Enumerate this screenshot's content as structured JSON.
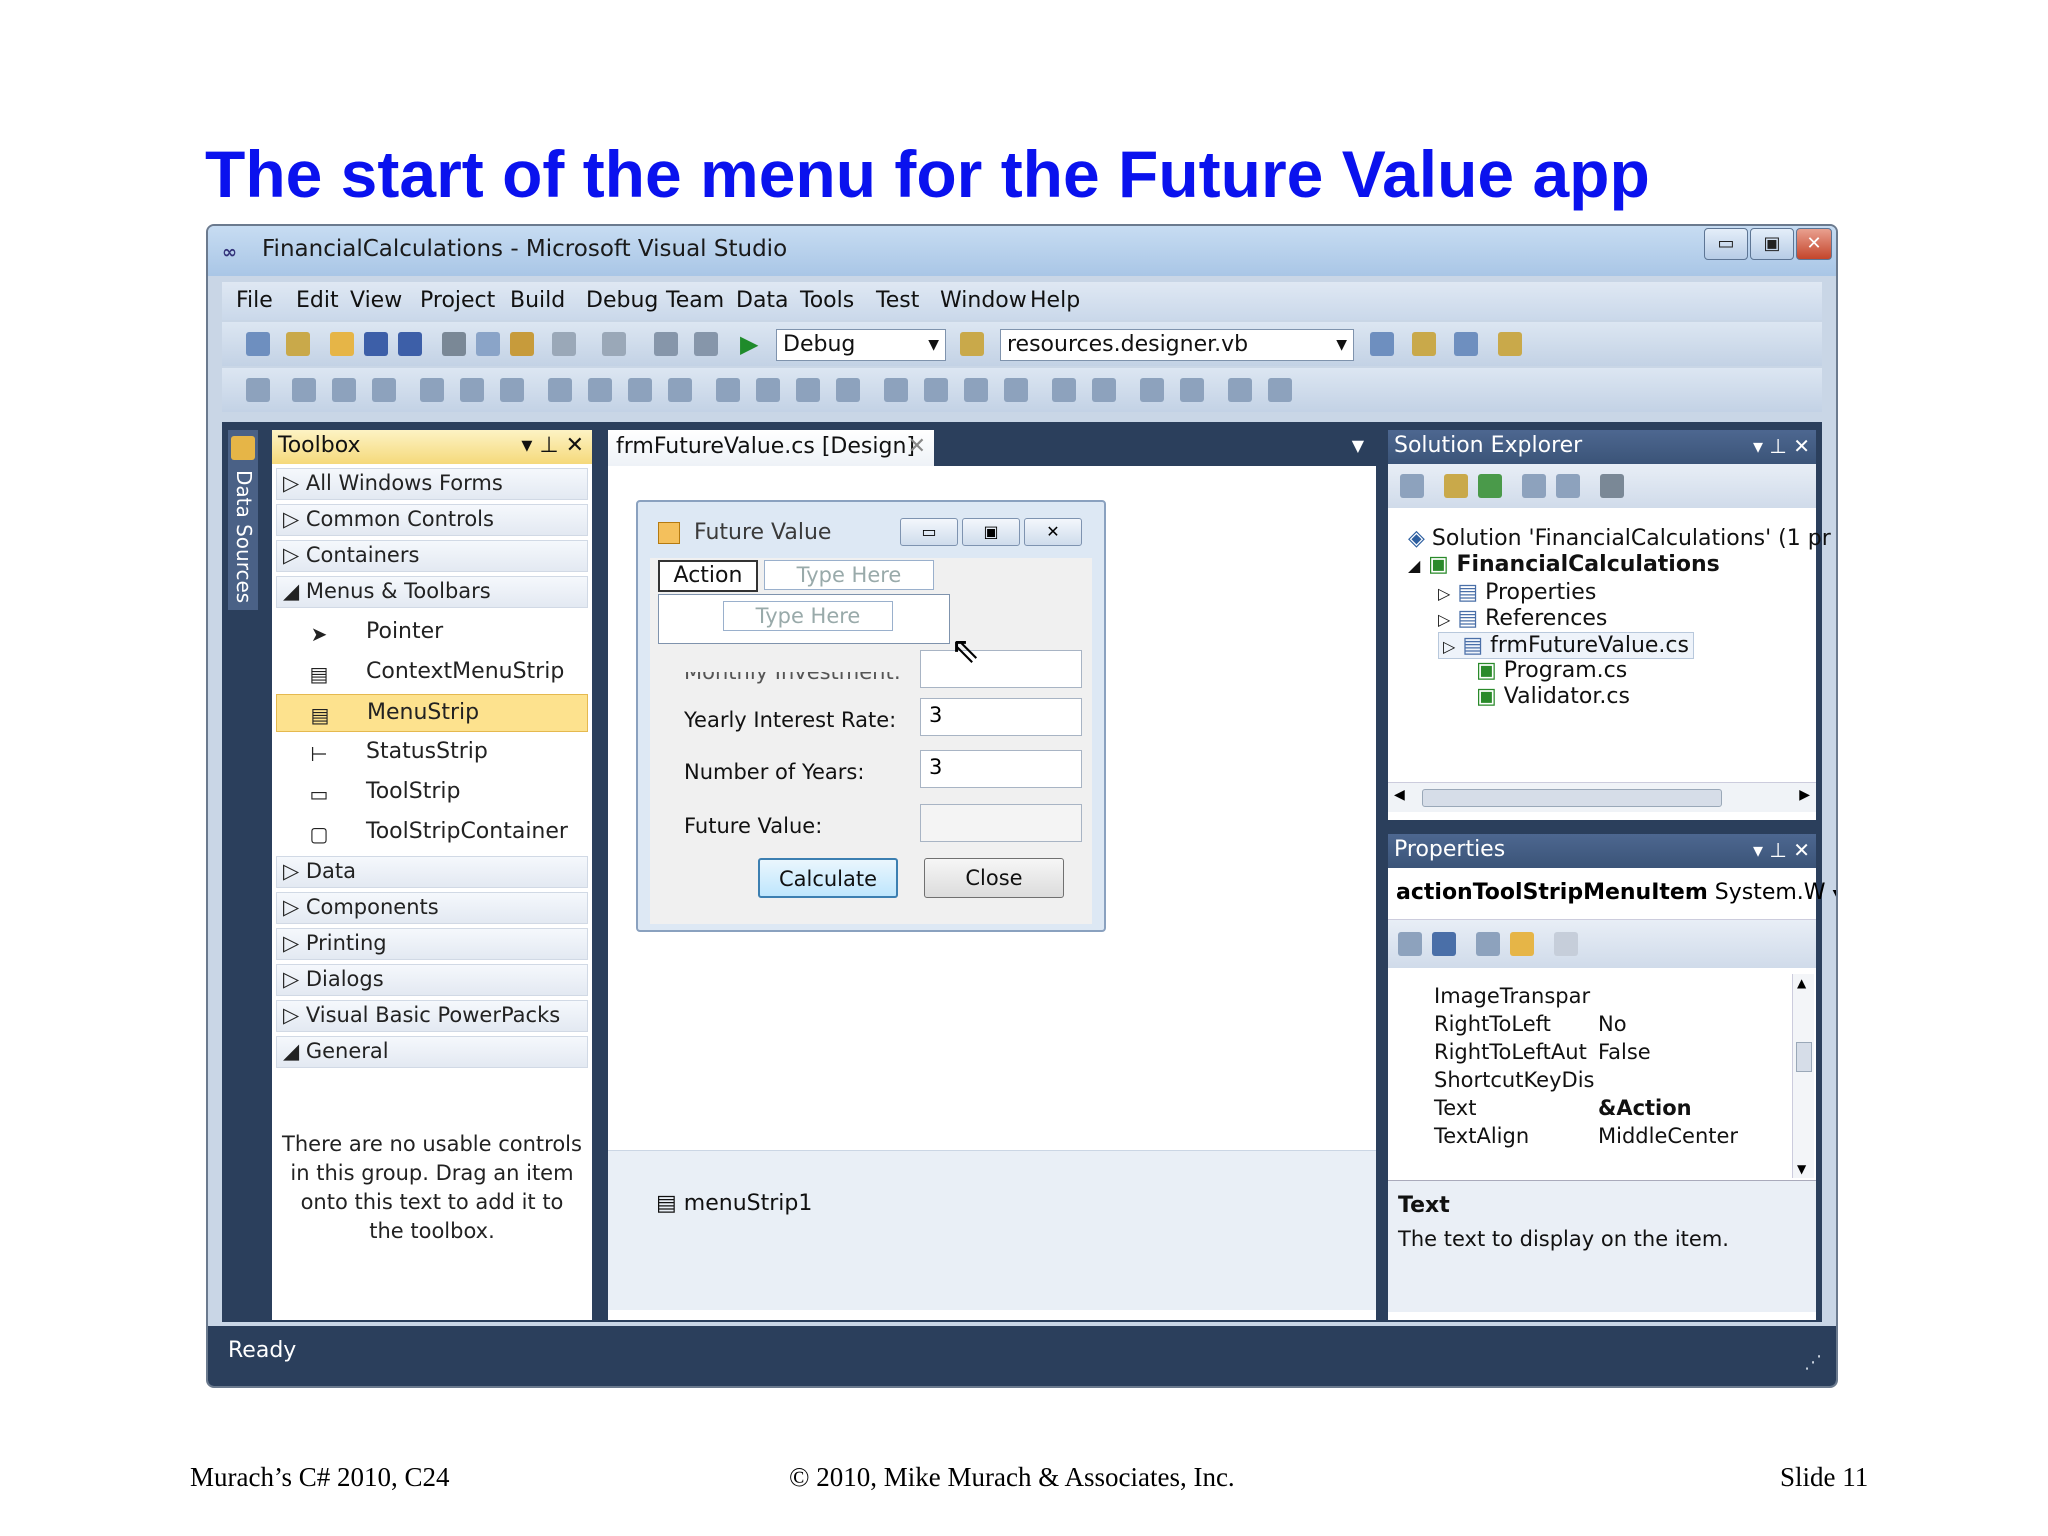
{
  "slide": {
    "title": "The start of the menu for the Future Value app",
    "footer_left": "Murach’s C# 2010, C24",
    "footer_mid": "© 2010, Mike Murach & Associates, Inc.",
    "footer_right": "Slide 11"
  },
  "window": {
    "title": "FinancialCalculations - Microsoft Visual Studio",
    "btn_min": "▭",
    "btn_max": "▣",
    "btn_close": "✕"
  },
  "menubar": [
    "File",
    "Edit",
    "View",
    "Project",
    "Build",
    "Debug",
    "Team",
    "Data",
    "Tools",
    "Test",
    "Window",
    "Help"
  ],
  "toolbar": {
    "config": "Debug",
    "find": "resources.designer.vb"
  },
  "side_strip": {
    "label": "Data Sources"
  },
  "toolbox": {
    "title": "Toolbox",
    "categories_top": [
      "All Windows Forms",
      "Common Controls",
      "Containers",
      "Menus & Toolbars"
    ],
    "items": [
      {
        "icon": "pointer-icon",
        "glyph": "➤",
        "label": "Pointer"
      },
      {
        "icon": "context-menu-strip-icon",
        "glyph": "▤",
        "label": "ContextMenuStrip"
      },
      {
        "icon": "menu-strip-icon",
        "glyph": "▤",
        "label": "MenuStrip"
      },
      {
        "icon": "status-strip-icon",
        "glyph": "⊢",
        "label": "StatusStrip"
      },
      {
        "icon": "tool-strip-icon",
        "glyph": "▭",
        "label": "ToolStrip"
      },
      {
        "icon": "tool-strip-container-icon",
        "glyph": "▢",
        "label": "ToolStripContainer"
      }
    ],
    "categories_bottom": [
      "Data",
      "Components",
      "Printing",
      "Dialogs",
      "Visual Basic PowerPacks",
      "General"
    ],
    "empty_message": "There are no usable controls in this group. Drag an item onto this text to add it to the toolbox."
  },
  "designer": {
    "tab": "frmFutureValue.cs [Design]",
    "tray_item": "menuStrip1",
    "form": {
      "title": "Future Value",
      "menu_action": "Action",
      "type_here": "Type Here",
      "type_here_sub": "Type Here",
      "labels": [
        "Monthly Investment:",
        "Yearly Interest Rate:",
        "Number of Years:",
        "Future Value:"
      ],
      "values": [
        "",
        "3",
        "3",
        ""
      ],
      "btn_calculate": "Calculate",
      "btn_close": "Close"
    }
  },
  "solution_explorer": {
    "title": "Solution Explorer",
    "solution": "Solution 'FinancialCalculations' (1 pr",
    "project": "FinancialCalculations",
    "items": [
      "Properties",
      "References",
      "frmFutureValue.cs",
      "Program.cs",
      "Validator.cs"
    ]
  },
  "properties": {
    "title": "Properties",
    "object": "actionToolStripMenuItem",
    "object_type": "System.W",
    "rows": [
      {
        "name": "ImageTranspar",
        "value": ""
      },
      {
        "name": "RightToLeft",
        "value": "No"
      },
      {
        "name": "RightToLeftAut",
        "value": "False"
      },
      {
        "name": "ShortcutKeyDis",
        "value": ""
      },
      {
        "name": "Text",
        "value": "&Action"
      },
      {
        "name": "TextAlign",
        "value": "MiddleCenter"
      }
    ],
    "desc_title": "Text",
    "desc_text": "The text to display on the item."
  },
  "status": "Ready"
}
